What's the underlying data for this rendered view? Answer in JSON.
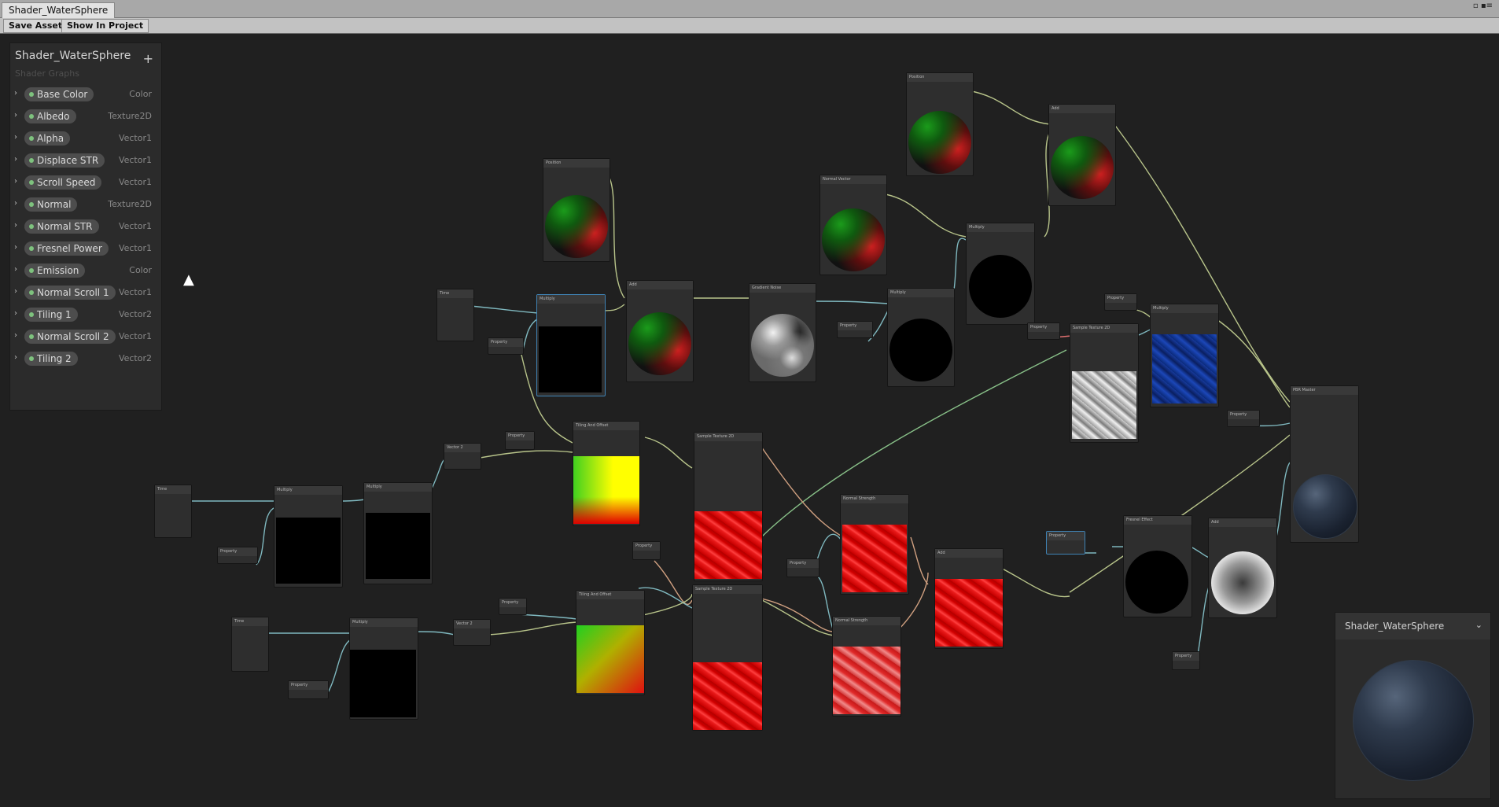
{
  "window": {
    "tab_title": "Shader_WaterSphere",
    "controls": "▫ ▪≡"
  },
  "toolbar": {
    "save_asset": "Save Asset",
    "show_in_project": "Show In Project"
  },
  "blackboard": {
    "title": "Shader_WaterSphere",
    "subtitle": "Shader Graphs",
    "add_symbol": "+",
    "arrow": "›",
    "properties": [
      {
        "name": "Base Color",
        "type": "Color"
      },
      {
        "name": "Albedo",
        "type": "Texture2D"
      },
      {
        "name": "Alpha",
        "type": "Vector1"
      },
      {
        "name": "Displace STR",
        "type": "Vector1"
      },
      {
        "name": "Scroll Speed",
        "type": "Vector1"
      },
      {
        "name": "Normal",
        "type": "Texture2D"
      },
      {
        "name": "Normal STR",
        "type": "Vector1"
      },
      {
        "name": "Fresnel Power",
        "type": "Vector1"
      },
      {
        "name": "Emission",
        "type": "Color"
      },
      {
        "name": "Normal Scroll 1",
        "type": "Vector1"
      },
      {
        "name": "Tiling 1",
        "type": "Vector2"
      },
      {
        "name": "Normal Scroll 2",
        "type": "Vector1"
      },
      {
        "name": "Tiling 2",
        "type": "Vector2"
      }
    ]
  },
  "nodes": {
    "position_top": "Position",
    "add_top": "Add",
    "position_mid": "Position",
    "normal_vector": "Normal Vector",
    "multiply_nv": "Multiply",
    "time_1": "Time",
    "multiply_sel": "Multiply",
    "add_mid": "Add",
    "gradient_noise": "Gradient Noise",
    "multiply_disp": "Multiply",
    "property_scroll": "Property",
    "property_displace": "Property",
    "property_basecolor": "Property",
    "multiply_albedo": "Multiply",
    "property_albedo": "Property",
    "sample_texture_albedo": "Sample Texture 2D",
    "pbr_master": "PBR Master",
    "property_emission": "Property",
    "time_2": "Time",
    "multiply_b1": "Multiply",
    "multiply_b2": "Multiply",
    "vector2_a": "Vector 2",
    "property_tiling1": "Property",
    "tiling_offset_a": "Tiling And Offset",
    "sample_texture_n1": "Sample Texture 2D",
    "normal_strength_a": "Normal Strength",
    "property_normal": "Property",
    "property_normal_str": "Property",
    "add_normals": "Add",
    "property_fresnel": "Property",
    "fresnel_effect": "Fresnel Effect",
    "add_fresnel": "Add",
    "time_3": "Time",
    "multiply_c1": "Multiply",
    "vector2_b": "Vector 2",
    "property_tiling2": "Property",
    "tiling_offset_b": "Tiling And Offset",
    "sample_texture_n2": "Sample Texture 2D",
    "normal_strength_b": "Normal Strength",
    "property_alpha": "Property",
    "property_scroll1": "Property",
    "property_scroll2": "Property"
  },
  "main_preview": {
    "title": "Shader_WaterSphere",
    "chevron": "⌄"
  }
}
